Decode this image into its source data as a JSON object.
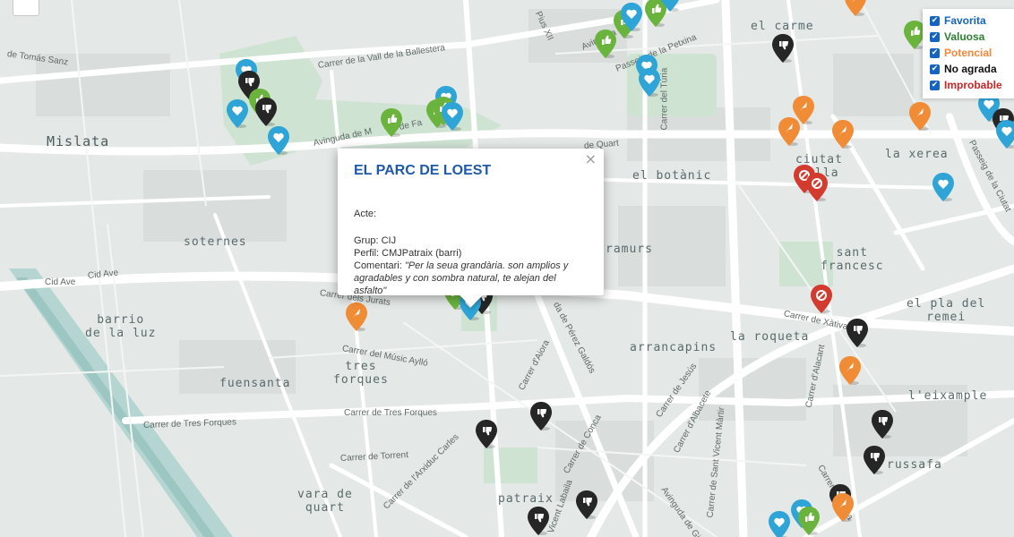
{
  "map": {
    "neighborhoods": {
      "mislata": "Mislata",
      "soternes": "soternes",
      "barrio_luz": "barrio\nde la luz",
      "tres_forques": "tres\nforques",
      "fuensanta": "fuensanta",
      "vara_de_quart": "vara de\nquart",
      "patraix": "patraix",
      "arrancapins": "arrancapins",
      "la_roqueta": "la roqueta",
      "el_botanic": "el botànic",
      "el_carme": "el carme",
      "ciutat_vella": "ciutat\nvella",
      "la_xerea": "la xerea",
      "sant_francesc": "sant\nfrancesc",
      "el_pla_del_remei": "el pla del\nremei",
      "l_eixample": "l'eixample",
      "russafa": "russafa",
      "tramurs": "ramurs"
    },
    "streets": {
      "tomas_sanz": "de Tomás Sanz",
      "vall_ballestera": "Carrer de la Vall de la Ballestera",
      "pius_xii": "Pius XII",
      "avinguda_top": "Avinguda",
      "passeig_petxina": "Passeig de la Petxina",
      "carrer_turia": "Carrer del Túria",
      "avinguda_mf": "Avinguda de M",
      "avinguda_fa": "de Fa",
      "quart": "de Quart",
      "cid_ave_1": "Cid Ave",
      "cid_ave_2": "Cid Ave",
      "jurats": "Carrer dels Jurats",
      "music_aylon": "Carrer del Músic Aylló",
      "perez_galdos": "da de Pérez Galdós",
      "carrer_aiora": "Carrer d'Aiora",
      "carrer_jesus": "Carrer de Jesús",
      "carrer_albacete": "Carrer d'Albacete",
      "carrer_alacant": "Carrer d'Alacant",
      "carrer_xativa": "Carrer de Xàtiva",
      "sant_vicent": "Carrer de Sant Vicent Màrtir",
      "tres_forques_1": "Carrer de Tres Forques",
      "tres_forques_2": "Carrer de Tres Forques",
      "torrent": "Carrer de Torrent",
      "arxiduc_carles": "Carrer de l'Arxiduc Carles",
      "conca": "Carrer de Conca",
      "avinguda_gi": "Avinguda de Gi",
      "labaila": "Vicent Labaila",
      "cuba": "Carrer de Cuba",
      "passeig_ciutat": "Passeig de la Ciutat"
    }
  },
  "legend": [
    {
      "label": "Favorita",
      "color": "#1565c0"
    },
    {
      "label": "Valuosa",
      "color": "#2e7d32"
    },
    {
      "label": "Potencial",
      "color": "#f4883a"
    },
    {
      "label": "No agrada",
      "color": "#111111"
    },
    {
      "label": "Improbable",
      "color": "#c62828"
    }
  ],
  "popup": {
    "title": "EL PARC DE LOEST",
    "close": "×",
    "acte": "Acte:",
    "grup": "Grup: CIJ",
    "perfil": "Perfil: CMJPatraix (barri)",
    "comentari_label": "Comentari:",
    "comentari": "\"Per la seua grandària. son amplios y agradables y con sombra natural, te alejan del asfalto\""
  },
  "marker_colors": {
    "favorita": "#2fa4d7",
    "valuosa": "#6ab43d",
    "potencial": "#f08c36",
    "no_agrada": "#262626",
    "improbable": "#d43b2f"
  }
}
